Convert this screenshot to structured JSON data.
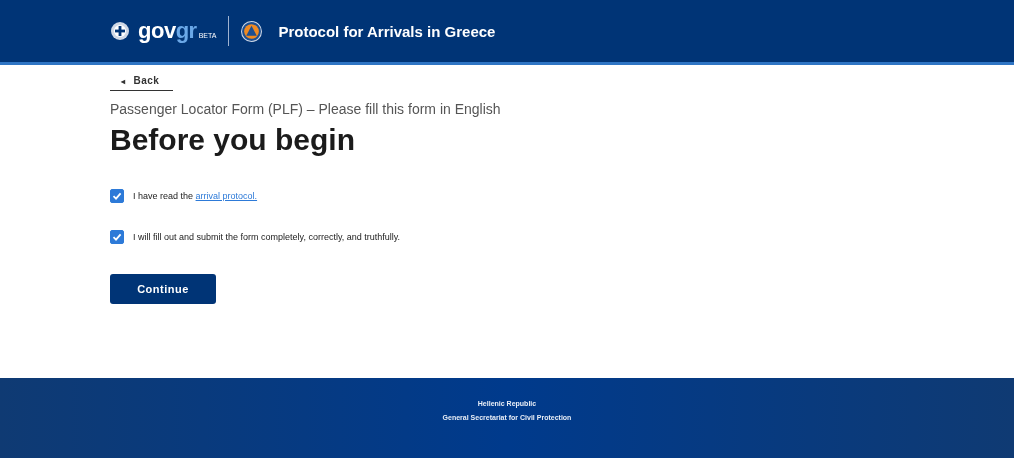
{
  "header": {
    "logo": {
      "gov": "gov",
      "gr": "gr",
      "badge": "BETA"
    },
    "title": "Protocol for Arrivals in Greece"
  },
  "back": {
    "arrow": "◂",
    "label": "Back"
  },
  "subtitle": "Passenger Locator Form (PLF) – Please fill this form in English",
  "heading": "Before you begin",
  "checkboxes": [
    {
      "text": "I have read the ",
      "link": "arrival protocol.",
      "checked": true
    },
    {
      "text": "I will fill out and submit the form completely, correctly, and truthfully.",
      "checked": true
    }
  ],
  "button": "Continue",
  "footer": [
    "Hellenic Republic",
    "General Secretariat for Civil Protection"
  ]
}
